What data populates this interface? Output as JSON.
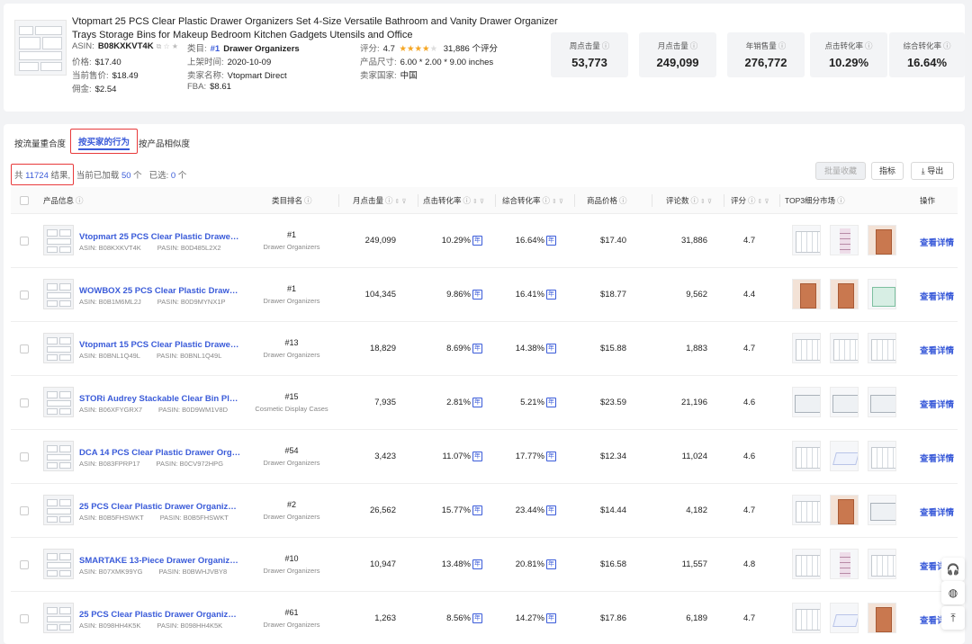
{
  "product": {
    "title": "Vtopmart 25 PCS Clear Plastic Drawer Organizers Set 4-Size Versatile Bathroom and Vanity Drawer Organizer Trays Storage Bins for Makeup Bedroom Kitchen Gadgets Utensils and Office",
    "asin_label": "ASIN:",
    "asin": "B08KXKVT4K",
    "price_label": "价格:",
    "price": "$17.40",
    "current_price_label": "当前售价:",
    "current_price": "$18.49",
    "commission_label": "佣金:",
    "commission": "$2.54",
    "category_label": "类目:",
    "category_rank": "#1",
    "category": "Drawer Organizers",
    "listed_label": "上架时间:",
    "listed": "2020-10-09",
    "seller_label": "卖家名称:",
    "seller": "Vtopmart Direct",
    "fba_label": "FBA:",
    "fba": "$8.61",
    "rating_label": "评分:",
    "rating": "4.7",
    "reviews": "31,886 个评分",
    "size_label": "产品尺寸:",
    "size": "6.00 * 2.00 * 9.00 inches",
    "country_label": "卖家国家:",
    "country": "中国"
  },
  "metrics": [
    {
      "label": "周点击量",
      "value": "53,773"
    },
    {
      "label": "月点击量",
      "value": "249,099"
    },
    {
      "label": "年销售量",
      "value": "276,772"
    },
    {
      "label": "点击转化率",
      "value": "10.29%"
    },
    {
      "label": "综合转化率",
      "value": "16.64%"
    }
  ],
  "tabs": [
    "按流量重合度",
    "按买家的行为",
    "按产品相似度"
  ],
  "results": {
    "prefix": "共",
    "total": "11724",
    "suffix": "结果,",
    "loaded_prefix": "当前已加载",
    "loaded": "50",
    "loaded_suffix": "个",
    "selected_prefix": "已选:",
    "selected": "0",
    "selected_suffix": "个"
  },
  "buttons": {
    "collect": "批量收藏",
    "metrics": "指标",
    "export": "导出"
  },
  "columns": {
    "product": "产品信息",
    "category_rank": "类目排名",
    "monthly_clicks": "月点击量",
    "click_cr": "点击转化率",
    "overall_cr": "综合转化率",
    "price": "商品价格",
    "reviews": "评论数",
    "rating": "评分",
    "top3": "TOP3细分市场",
    "action": "操作"
  },
  "row_tag": "年",
  "row_action": "查看详情",
  "rows": [
    {
      "name": "Vtopmart 25 PCS Clear Plastic Drawer Or...",
      "asin": "ASIN: B08KXKVT4K",
      "pasin": "PASIN: B0D485L2X2",
      "rank": "#1",
      "category": "Drawer Organizers",
      "clicks": "249,099",
      "click_cr": "10.29%",
      "overall_cr": "16.64%",
      "price": "$17.40",
      "reviews": "31,886",
      "rating": "4.7",
      "minis": [
        "grey",
        "tower",
        "warm"
      ]
    },
    {
      "name": "WOWBOX 25 PCS Clear Plastic Drawer Or...",
      "asin": "ASIN: B0B1M6ML2J",
      "pasin": "PASIN: B0D9MYNX1P",
      "rank": "#1",
      "category": "Drawer Organizers",
      "clicks": "104,345",
      "click_cr": "9.86%",
      "overall_cr": "16.41%",
      "price": "$18.77",
      "reviews": "9,562",
      "rating": "4.4",
      "minis": [
        "warm",
        "warm",
        "green"
      ]
    },
    {
      "name": "Vtopmart 15 PCS Clear Plastic Drawer Org...",
      "asin": "ASIN: B0BNL1Q49L",
      "pasin": "PASIN: B0BNL1Q49L",
      "rank": "#13",
      "category": "Drawer Organizers",
      "clicks": "18,829",
      "click_cr": "8.69%",
      "overall_cr": "14.38%",
      "price": "$15.88",
      "reviews": "1,883",
      "rating": "4.7",
      "minis": [
        "grey",
        "grey",
        "grey"
      ]
    },
    {
      "name": "STORi Audrey Stackable Clear Bin Plastic ...",
      "asin": "ASIN: B06XFYGRX7",
      "pasin": "PASIN: B0D9WM1V8D",
      "rank": "#15",
      "category": "Cosmetic Display Cases",
      "clicks": "7,935",
      "click_cr": "2.81%",
      "overall_cr": "5.21%",
      "price": "$23.59",
      "reviews": "21,196",
      "rating": "4.6",
      "minis": [
        "bins",
        "bins",
        "bins"
      ]
    },
    {
      "name": "DCA 14 PCS Clear Plastic Drawer Organiz...",
      "asin": "ASIN: B083FPRP17",
      "pasin": "PASIN: B0CV972HPG",
      "rank": "#54",
      "category": "Drawer Organizers",
      "clicks": "3,423",
      "click_cr": "11.07%",
      "overall_cr": "17.77%",
      "price": "$12.34",
      "reviews": "11,024",
      "rating": "4.6",
      "minis": [
        "grey",
        "tray",
        "grey"
      ]
    },
    {
      "name": "25 PCS Clear Plastic Drawer Organizers S...",
      "asin": "ASIN: B0B5FHSWKT",
      "pasin": "PASIN: B0B5FHSWKT",
      "rank": "#2",
      "category": "Drawer Organizers",
      "clicks": "26,562",
      "click_cr": "15.77%",
      "overall_cr": "23.44%",
      "price": "$14.44",
      "reviews": "4,182",
      "rating": "4.7",
      "minis": [
        "grey",
        "warm",
        "bins"
      ]
    },
    {
      "name": "SMARTAKE 13-Piece Drawer Organizers ...",
      "asin": "ASIN: B07XMK99YG",
      "pasin": "PASIN: B0BWHJVBY8",
      "rank": "#10",
      "category": "Drawer Organizers",
      "clicks": "10,947",
      "click_cr": "13.48%",
      "overall_cr": "20.81%",
      "price": "$16.58",
      "reviews": "11,557",
      "rating": "4.8",
      "minis": [
        "grey",
        "tower",
        "grey"
      ]
    },
    {
      "name": "25 PCS Clear Plastic Drawer Organizers S...",
      "asin": "ASIN: B098HH4K5K",
      "pasin": "PASIN: B098HH4K5K",
      "rank": "#61",
      "category": "Drawer Organizers",
      "clicks": "1,263",
      "click_cr": "8.56%",
      "overall_cr": "14.27%",
      "price": "$17.86",
      "reviews": "6,189",
      "rating": "4.7",
      "minis": [
        "grey",
        "tray",
        "warm"
      ]
    }
  ],
  "float_icons": [
    "headset-icon",
    "globe-icon",
    "back-to-top-icon"
  ],
  "colors": {
    "accent": "#3a5bd9",
    "highlight_border": "#e8393a",
    "star": "#f5a623"
  }
}
